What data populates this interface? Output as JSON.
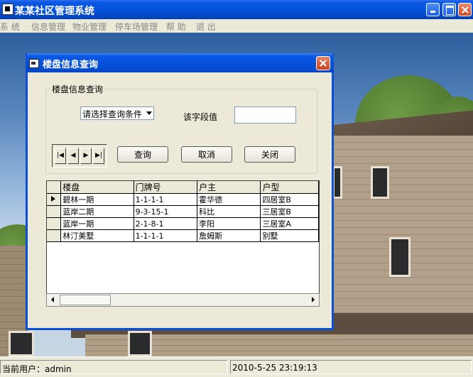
{
  "app": {
    "title": "某某社区管理系统"
  },
  "menu": [
    "系 统",
    "信息管理",
    "物业管理",
    "停车场管理",
    "帮 助",
    "退 出"
  ],
  "dialog": {
    "title": "楼盘信息查询",
    "group_label": "楼盘信息查询",
    "query_select": "请选择查询条件",
    "field_label": "该字段值",
    "field_value": "",
    "nav": {
      "first": "|◀",
      "prev": "◀",
      "next": "▶",
      "last": "▶|"
    },
    "buttons": {
      "query": "查询",
      "cancel": "取消",
      "close": "关闭"
    },
    "grid": {
      "headers": [
        "楼盘",
        "门牌号",
        "户主",
        "户型"
      ],
      "rows": [
        [
          "碧林一期",
          "1-1-1-1",
          "霍华德",
          "四居室B"
        ],
        [
          "蓝岸二期",
          "9-3-15-1",
          "科比",
          "三居室B"
        ],
        [
          "蓝岸一期",
          "2-1-8-1",
          "李阳",
          "三居室A"
        ],
        [
          "林汀美墅",
          "1-1-1-1",
          "詹姆斯",
          "别墅"
        ]
      ]
    }
  },
  "status": {
    "user": "当前用户：admin",
    "datetime": "2010-5-25 23:19:13"
  }
}
